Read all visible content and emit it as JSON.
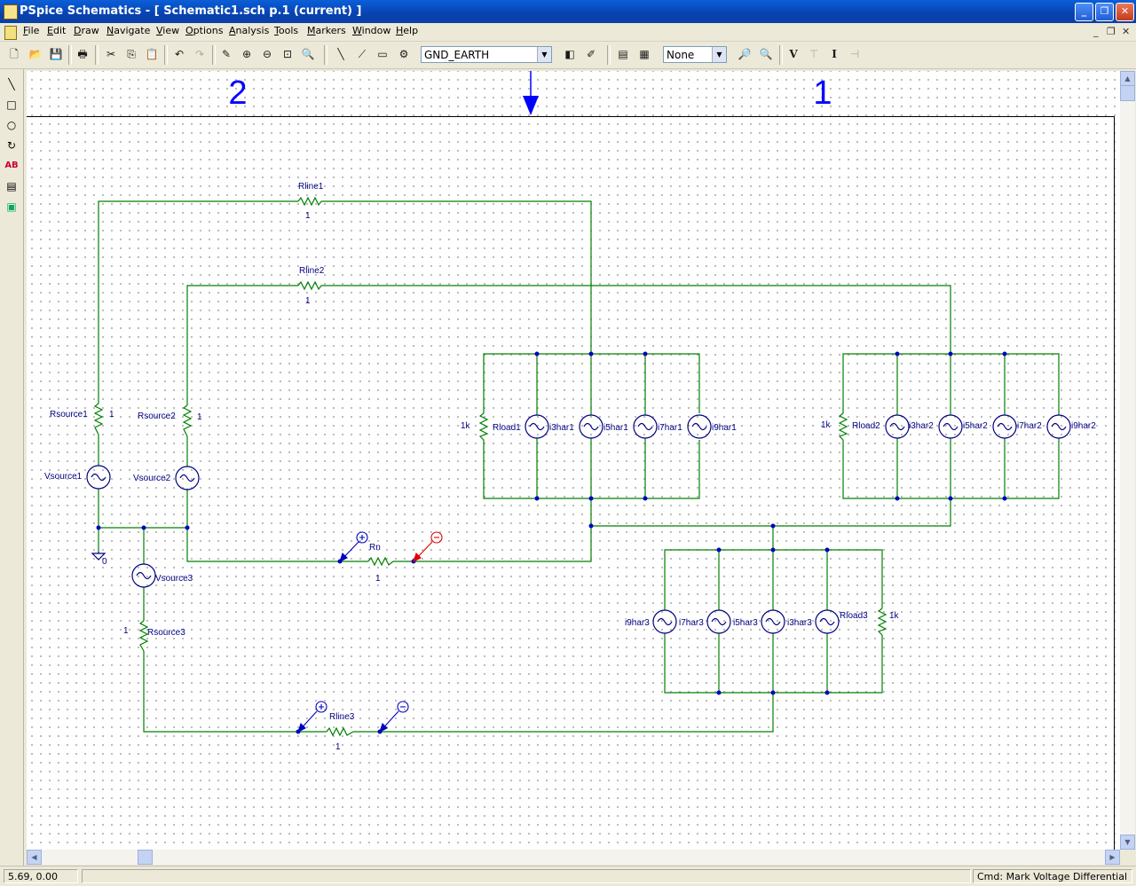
{
  "window": {
    "title": "PSpice Schematics - [ Schematic1.sch  p.1 (current)  ]",
    "minimize": "_",
    "restore": "❐",
    "close": "✕"
  },
  "menu": [
    {
      "label": "File",
      "u": "F",
      "rest": "ile"
    },
    {
      "label": "Edit",
      "u": "E",
      "rest": "dit"
    },
    {
      "label": "Draw",
      "u": "D",
      "rest": "raw"
    },
    {
      "label": "Navigate",
      "u": "N",
      "rest": "avigate"
    },
    {
      "label": "View",
      "u": "V",
      "rest": "iew"
    },
    {
      "label": "Options",
      "u": "O",
      "rest": "ptions"
    },
    {
      "label": "Analysis",
      "u": "A",
      "rest": "nalysis"
    },
    {
      "label": "Tools",
      "u": "T",
      "rest": "ools"
    },
    {
      "label": "Markers",
      "u": "M",
      "rest": "arkers"
    },
    {
      "label": "Window",
      "u": "W",
      "rest": "indow"
    },
    {
      "label": "Help",
      "u": "H",
      "rest": "elp"
    }
  ],
  "mdi_controls": {
    "minimize": "_",
    "restore": "❐",
    "close": "✕"
  },
  "toolbar": {
    "part_combo": "GND_EARTH",
    "marker_combo": "None",
    "icons": {
      "new": "🗋",
      "open": "📂",
      "save": "💾",
      "print": "🖶",
      "cut": "✂",
      "copy": "⎘",
      "paste": "📋",
      "undo": "↶",
      "redo": "↷",
      "redraw": "✎",
      "zoom_in": "⊕",
      "zoom_out": "⊖",
      "zoom_area": "⊡",
      "zoom_fit": "🔍",
      "wire": "╲",
      "bus": "⟋",
      "block": "▭",
      "get_part": "⚙",
      "edit_attr": "◧",
      "edit_sym": "✐",
      "setup": "▤",
      "simulate": "▦",
      "probe1": "🔎",
      "probe2": "🔍",
      "volt_marker": "V",
      "volt_diff": "⊤",
      "current_marker": "I",
      "power_marker": "⊣"
    }
  },
  "left_tools": [
    "╲",
    "□",
    "○",
    "↻",
    "AB",
    "▤",
    "▣"
  ],
  "schematic": {
    "border_labels": [
      "2",
      "1"
    ],
    "parts": {
      "rline1": "Rline1",
      "rline2": "Rline2",
      "rline3": "Rline3",
      "rn": "Rn",
      "rsource1": "Rsource1",
      "rsource2": "Rsource2",
      "rsource3": "Rsource3",
      "vsource1": "Vsource1",
      "vsource2": "Vsource2",
      "vsource3": "Vsource3",
      "rload1": "Rload1",
      "rload2": "Rload2",
      "rload3": "Rload3",
      "i3har1": "i3har1",
      "i5har1": "i5har1",
      "i7har1": "i7har1",
      "i9har1": "i9har1",
      "i3har2": "i3har2",
      "i5har2": "i5har2",
      "i7har2": "i7har2",
      "i9har2": "i9har2",
      "i3har3": "i3har3",
      "i5har3": "i5har3",
      "i7har3": "i7har3",
      "i9har3": "i9har3",
      "one": "1",
      "oneK": "1k",
      "gnd": "0"
    }
  },
  "status": {
    "coords": "5.69, 0.00",
    "command": "Cmd: Mark Voltage Differential"
  }
}
